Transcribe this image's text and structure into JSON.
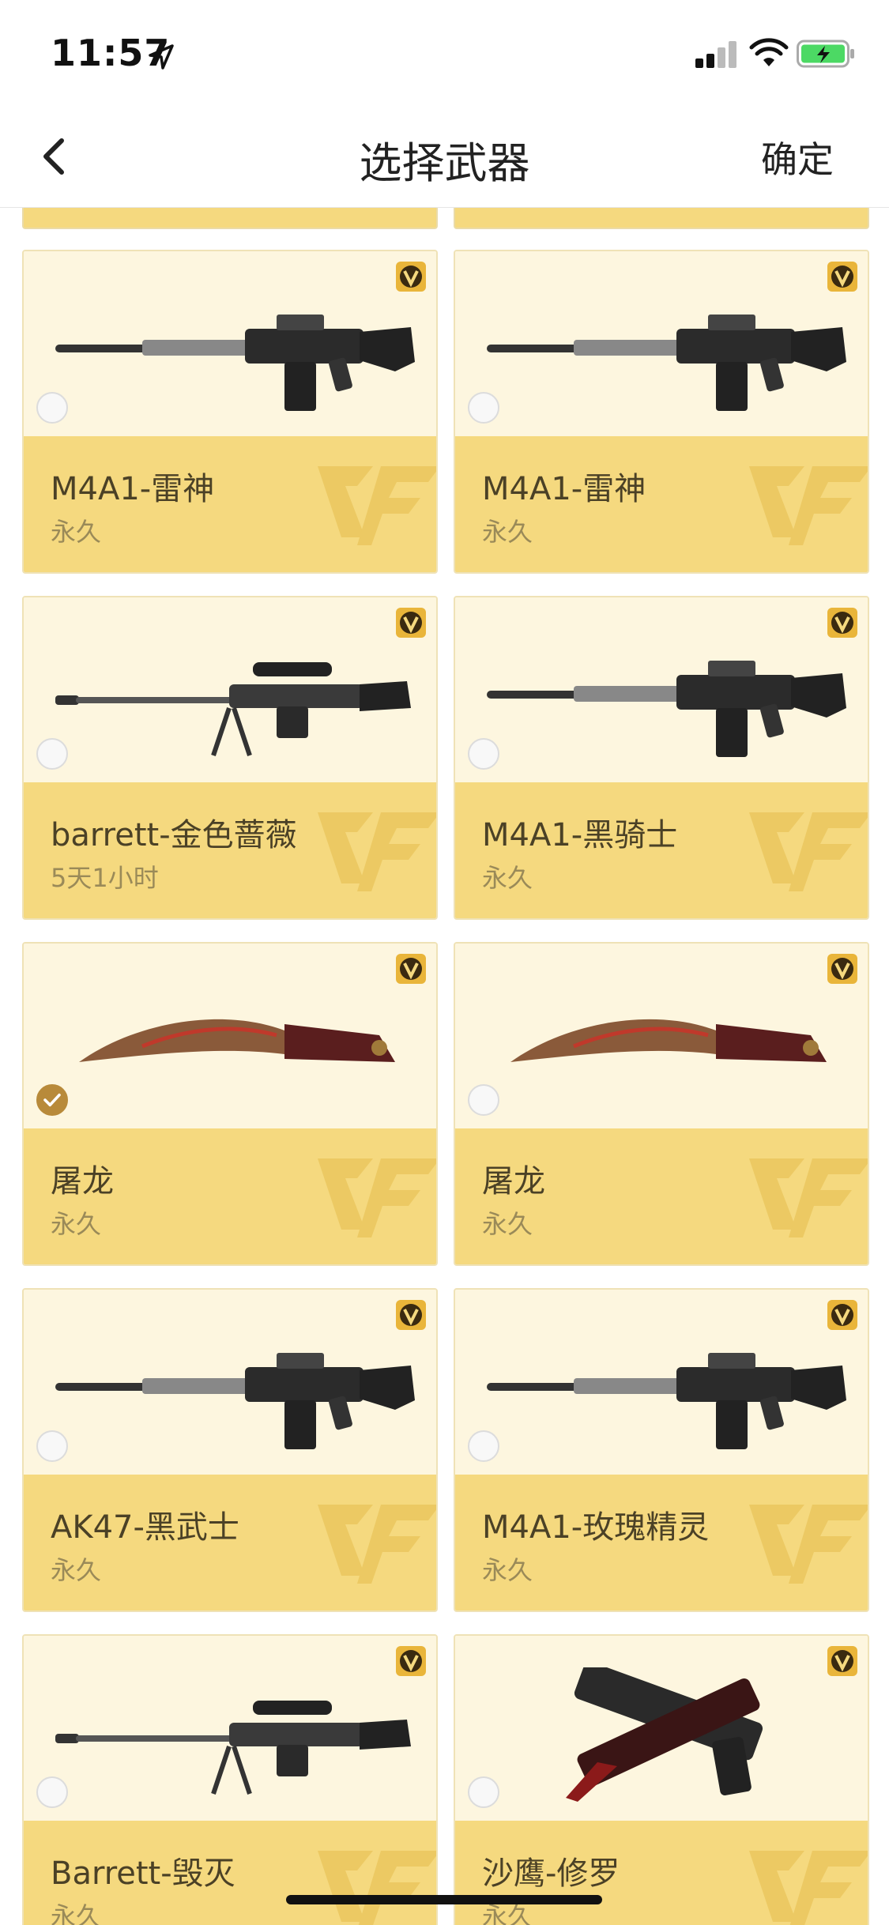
{
  "status_bar": {
    "time": "11:57"
  },
  "nav": {
    "title": "选择武器",
    "confirm_label": "确定"
  },
  "cards": [
    {
      "name": "M4A1-雷神",
      "duration": "永久",
      "weapon": "rifle-icon",
      "selected": false
    },
    {
      "name": "M4A1-雷神",
      "duration": "永久",
      "weapon": "rifle-icon",
      "selected": false
    },
    {
      "name": "barrett-金色蔷薇",
      "duration": "5天1小时",
      "weapon": "sniper-icon",
      "selected": false
    },
    {
      "name": "M4A1-黑骑士",
      "duration": "永久",
      "weapon": "rifle-icon",
      "selected": false
    },
    {
      "name": "屠龙",
      "duration": "永久",
      "weapon": "knife-icon",
      "selected": true
    },
    {
      "name": "屠龙",
      "duration": "永久",
      "weapon": "knife-icon",
      "selected": false
    },
    {
      "name": "AK47-黑武士",
      "duration": "永久",
      "weapon": "rifle-icon",
      "selected": false
    },
    {
      "name": "M4A1-玫瑰精灵",
      "duration": "永久",
      "weapon": "rifle-icon",
      "selected": false
    },
    {
      "name": "Barrett-毁灭",
      "duration": "永久",
      "weapon": "sniper-icon",
      "selected": false
    },
    {
      "name": "沙鹰-修罗",
      "duration": "永久",
      "weapon": "pistol-icon",
      "selected": false
    }
  ],
  "colors": {
    "card_top": "#fdf6df",
    "card_bottom": "#f5d97f",
    "selected": "#b88a3a",
    "v_badge": "#e9b53a"
  }
}
